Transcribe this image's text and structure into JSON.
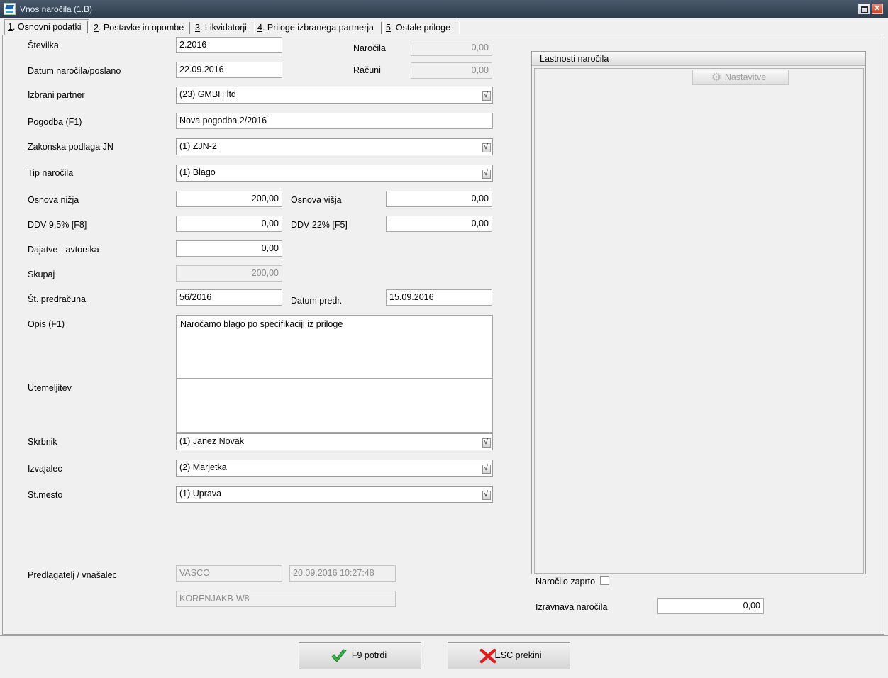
{
  "window": {
    "title": "Vnos naročila  (1.B)"
  },
  "tabs": [
    {
      "num": "1",
      "label": ". Osnovni podatki"
    },
    {
      "num": "2",
      "label": ". Postavke in opombe"
    },
    {
      "num": "3",
      "label": ". Likvidatorji"
    },
    {
      "num": "4",
      "label": ". Priloge izbranega partnerja"
    },
    {
      "num": "5",
      "label": ". Ostale priloge"
    }
  ],
  "form": {
    "stevilka": {
      "label": "Številka",
      "value": "2.2016"
    },
    "datum": {
      "label": "Datum naročila/poslano",
      "value": "22.09.2016"
    },
    "narocila": {
      "label": "Naročila",
      "value": "0,00"
    },
    "racuni": {
      "label": "Računi",
      "value": "0,00"
    },
    "partner": {
      "label": "Izbrani partner",
      "value": "(23) GMBH ltd"
    },
    "pogodba": {
      "label": "Pogodba (F1)",
      "value": "Nova pogodba 2/2016"
    },
    "zakonska": {
      "label": "Zakonska podlaga JN",
      "value": "(1) ZJN-2"
    },
    "tip": {
      "label": "Tip naročila",
      "value": "(1) Blago"
    },
    "osnova_nizja": {
      "label": "Osnova nižja",
      "value": "200,00"
    },
    "osnova_visja": {
      "label": "Osnova višja",
      "value": "0,00"
    },
    "ddv95": {
      "label": "DDV 9.5% [F8]",
      "value": "0,00"
    },
    "ddv22": {
      "label": "DDV 22% [F5]",
      "value": "0,00"
    },
    "dajatve": {
      "label": "Dajatve - avtorska",
      "value": "0,00"
    },
    "skupaj": {
      "label": "Skupaj",
      "value": "200,00"
    },
    "predracun": {
      "label": "Št. predračuna",
      "value": "56/2016"
    },
    "datum_predr": {
      "label": "Datum predr.",
      "value": "15.09.2016"
    },
    "opis": {
      "label": "Opis (F1)",
      "value": "Naročamo blago po specifikaciji iz priloge"
    },
    "utemeljitev": {
      "label": "Utemeljitev",
      "value": ""
    },
    "skrbnik": {
      "label": "Skrbnik",
      "value": "(1) Janez Novak"
    },
    "izvajalec": {
      "label": "Izvajalec",
      "value": "(2) Marjetka"
    },
    "stmesto": {
      "label": "St.mesto",
      "value": "(1) Uprava"
    },
    "predlagatelj": {
      "label": "Predlagatelj / vnašalec",
      "user": "VASCO",
      "timestamp": "20.09.2016 10:27:48",
      "computer": "KORENJAKB-W8"
    }
  },
  "properties": {
    "title": "Lastnosti naročila",
    "settings_button": "Nastavitve",
    "closed_label": "Naročilo zaprto",
    "closed_checked": false,
    "izravnava_label": "Izravnava naročila",
    "izravnava_value": "0,00"
  },
  "buttons": {
    "confirm": "F9 potrdi",
    "cancel": "ESC prekini"
  },
  "colors": {
    "titlebar": "#2d3b4b",
    "confirm_icon": "#3cb24a",
    "cancel_icon": "#d81e1e"
  }
}
